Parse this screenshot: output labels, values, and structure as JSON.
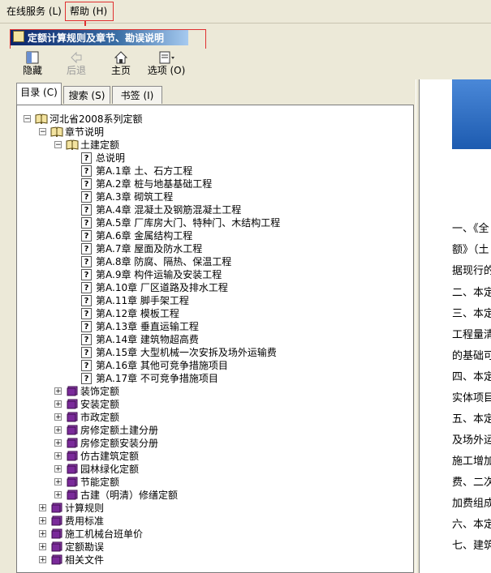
{
  "menubar": {
    "online_service": "在线服务 (L)",
    "help": "帮助 (H)"
  },
  "window": {
    "title": "定额计算规则及章节、勘误说明"
  },
  "toolbar": {
    "hide": "隐藏",
    "back": "后退",
    "home": "主页",
    "options": "选项 (O)"
  },
  "tabs": {
    "contents": "目录 (C)",
    "search": "搜索 (S)",
    "bookmarks": "书签 (I)"
  },
  "tree": {
    "root": "河北省2008系列定额",
    "chapter_notes": "章节说明",
    "civil": "土建定额",
    "civil_items": [
      "总说明",
      "第A.1章  土、石方工程",
      "第A.2章  桩与地基基础工程",
      "第A.3章  砌筑工程",
      "第A.4章  混凝土及钢筋混凝土工程",
      "第A.5章  厂库房大门、特种门、木结构工程",
      "第A.6章  金属结构工程",
      "第A.7章  屋面及防水工程",
      "第A.8章  防腐、隔热、保温工程",
      "第A.9章  构件运输及安装工程",
      "第A.10章  厂区道路及排水工程",
      "第A.11章  脚手架工程",
      "第A.12章  模板工程",
      "第A.13章  垂直运输工程",
      "第A.14章  建筑物超高费",
      "第A.15章  大型机械一次安拆及场外运输费",
      "第A.16章  其他可竞争措施项目",
      "第A.17章  不可竞争措施项目"
    ],
    "quota_books": [
      "装饰定额",
      "安装定额",
      "市政定额",
      "房修定额土建分册",
      "房修定额安装分册",
      "仿古建筑定额",
      "园林绿化定额",
      "节能定额",
      "古建（明清）修缮定额"
    ],
    "top_books": [
      "计算规则",
      "费用标准",
      "施工机械台班单价",
      "定额勘误",
      "相关文件"
    ]
  },
  "content": {
    "lines": [
      "一、《全",
      "额》（土",
      "据现行的",
      "二、本定",
      "三、本定",
      "工程量清",
      "的基础可",
      "四、本定",
      "实体项目",
      "五、本定",
      "及场外运",
      "施工增加",
      "费、二次",
      "加费组成",
      "六、本定",
      "七、建筑"
    ]
  }
}
